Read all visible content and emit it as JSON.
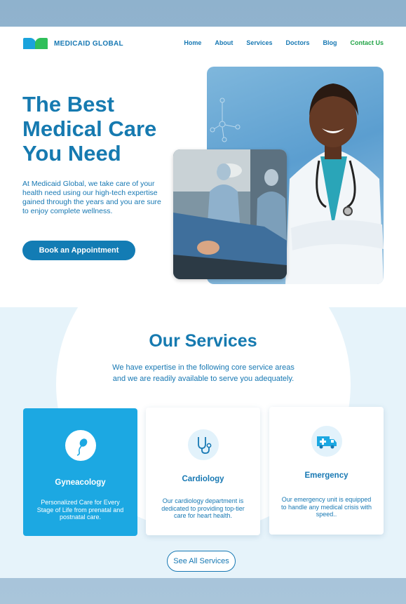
{
  "brand": {
    "name": "MEDICAID GLOBAL"
  },
  "nav": {
    "items": [
      "Home",
      "About",
      "Services",
      "Doctors",
      "Blog"
    ],
    "contact": "Contact Us"
  },
  "hero": {
    "title_line1": "The Best",
    "title_line2": "Medical Care",
    "title_line3": "You Need",
    "description": "At Medicaid Global, we take care of your health need using our high-tech expertise gained through the years and you are sure to enjoy complete wellness.",
    "cta": "Book an Appointment"
  },
  "services": {
    "title": "Our Services",
    "subtitle_line1": "We have expertise in the following core service areas",
    "subtitle_line2": "and we are readily available to serve you adequately.",
    "cards": [
      {
        "name": "Gyneacology",
        "icon": "sperm-icon",
        "description": "Personalized Care for Every Stage of Life from prenatal and postnatal care."
      },
      {
        "name": "Cardiology",
        "icon": "stethoscope-icon",
        "description": "Our cardiology department is dedicated to providing top-tier care for heart health."
      },
      {
        "name": "Emergency",
        "icon": "ambulance-icon",
        "description": "Our emergency unit is equipped to handle any medical crisis with speed.."
      }
    ],
    "see_all": "See All Services"
  },
  "colors": {
    "primary": "#167ab0",
    "accent": "#1ca8e2",
    "green": "#2fbf5a",
    "contact": "#22a447"
  }
}
